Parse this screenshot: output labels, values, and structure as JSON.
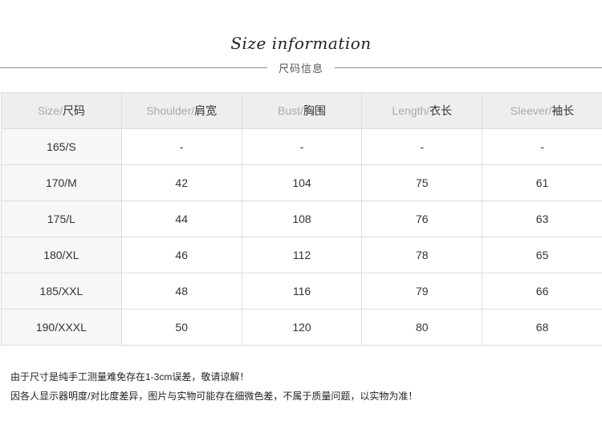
{
  "header": {
    "title": "Size information",
    "subtitle": "尺码信息"
  },
  "table": {
    "columns": [
      {
        "en": "Size/",
        "zh": "尺码"
      },
      {
        "en": "Shoulder/",
        "zh": "肩宽"
      },
      {
        "en": "Bust/",
        "zh": "胸围"
      },
      {
        "en": "Length/",
        "zh": "衣长"
      },
      {
        "en": "Sleever/",
        "zh": "袖长"
      }
    ],
    "rows": [
      [
        "165/S",
        "-",
        "-",
        "-",
        "-"
      ],
      [
        "170/M",
        "42",
        "104",
        "75",
        "61"
      ],
      [
        "175/L",
        "44",
        "108",
        "76",
        "63"
      ],
      [
        "180/XL",
        "46",
        "112",
        "78",
        "65"
      ],
      [
        "185/XXL",
        "48",
        "116",
        "79",
        "66"
      ],
      [
        "190/XXXL",
        "50",
        "120",
        "80",
        "68"
      ]
    ]
  },
  "notes": [
    "由于尺寸是纯手工测量难免存在1-3cm误差，敬请谅解！",
    "因各人显示器明度/对比度差异，图片与实物可能存在细微色差，不属于质量问题，以实物为准！"
  ],
  "colors": {
    "header_bg": "#eeeeee",
    "first_col_bg": "#f7f7f7",
    "border": "#dddddd",
    "header_en_text": "#aaaaaa",
    "text": "#333333"
  }
}
